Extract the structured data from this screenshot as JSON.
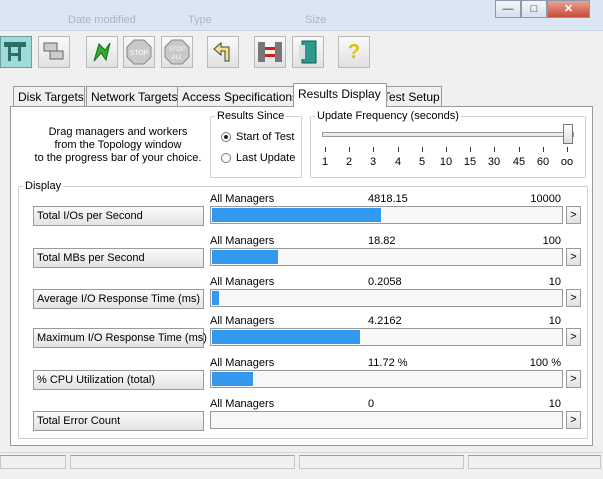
{
  "window": {
    "ghost_headers": [
      "Date modified",
      "Type",
      "Size"
    ],
    "minimize_glyph": "—",
    "maximize_glyph": "□",
    "close_glyph": "✕"
  },
  "toolbar": {
    "stop_label": "STOP",
    "stop_all_top": "STOP",
    "stop_all_bottom": "ALL",
    "help_glyph": "?"
  },
  "tabs": [
    "Disk Targets",
    "Network Targets",
    "Access Specifications",
    "Results Display",
    "Test Setup"
  ],
  "active_tab": 3,
  "info_text": [
    "Drag managers and workers",
    "from the Topology window",
    "to the progress bar of your choice."
  ],
  "results_since": {
    "title": "Results Since",
    "options": [
      "Start of Test",
      "Last Update"
    ],
    "selected": 0
  },
  "update_frequency": {
    "title": "Update Frequency (seconds)",
    "ticks": [
      "1",
      "2",
      "3",
      "4",
      "5",
      "10",
      "15",
      "30",
      "45",
      "60",
      "oo"
    ],
    "selected_index": 10
  },
  "display": {
    "title": "Display",
    "expand_label": ">",
    "rows": [
      {
        "button": "Total I/Os per Second",
        "manager": "All Managers",
        "value": "4818.15",
        "max": "10000",
        "fraction": 0.4818
      },
      {
        "button": "Total MBs per Second",
        "manager": "All Managers",
        "value": "18.82",
        "max": "100",
        "fraction": 0.1882
      },
      {
        "button": "Average I/O Response Time (ms)",
        "manager": "All Managers",
        "value": "0.2058",
        "max": "10",
        "fraction": 0.0206
      },
      {
        "button": "Maximum I/O Response Time (ms)",
        "manager": "All Managers",
        "value": "4.2162",
        "max": "10",
        "fraction": 0.4216
      },
      {
        "button": "% CPU Utilization (total)",
        "manager": "All Managers",
        "value": "11.72 %",
        "max": "100 %",
        "fraction": 0.1172
      },
      {
        "button": "Total Error Count",
        "manager": "All Managers",
        "value": "0",
        "max": "10",
        "fraction": 0
      }
    ]
  },
  "colors": {
    "bar": "#3399ee",
    "panel": "#ffffff",
    "chrome": "#f0f0f0"
  }
}
